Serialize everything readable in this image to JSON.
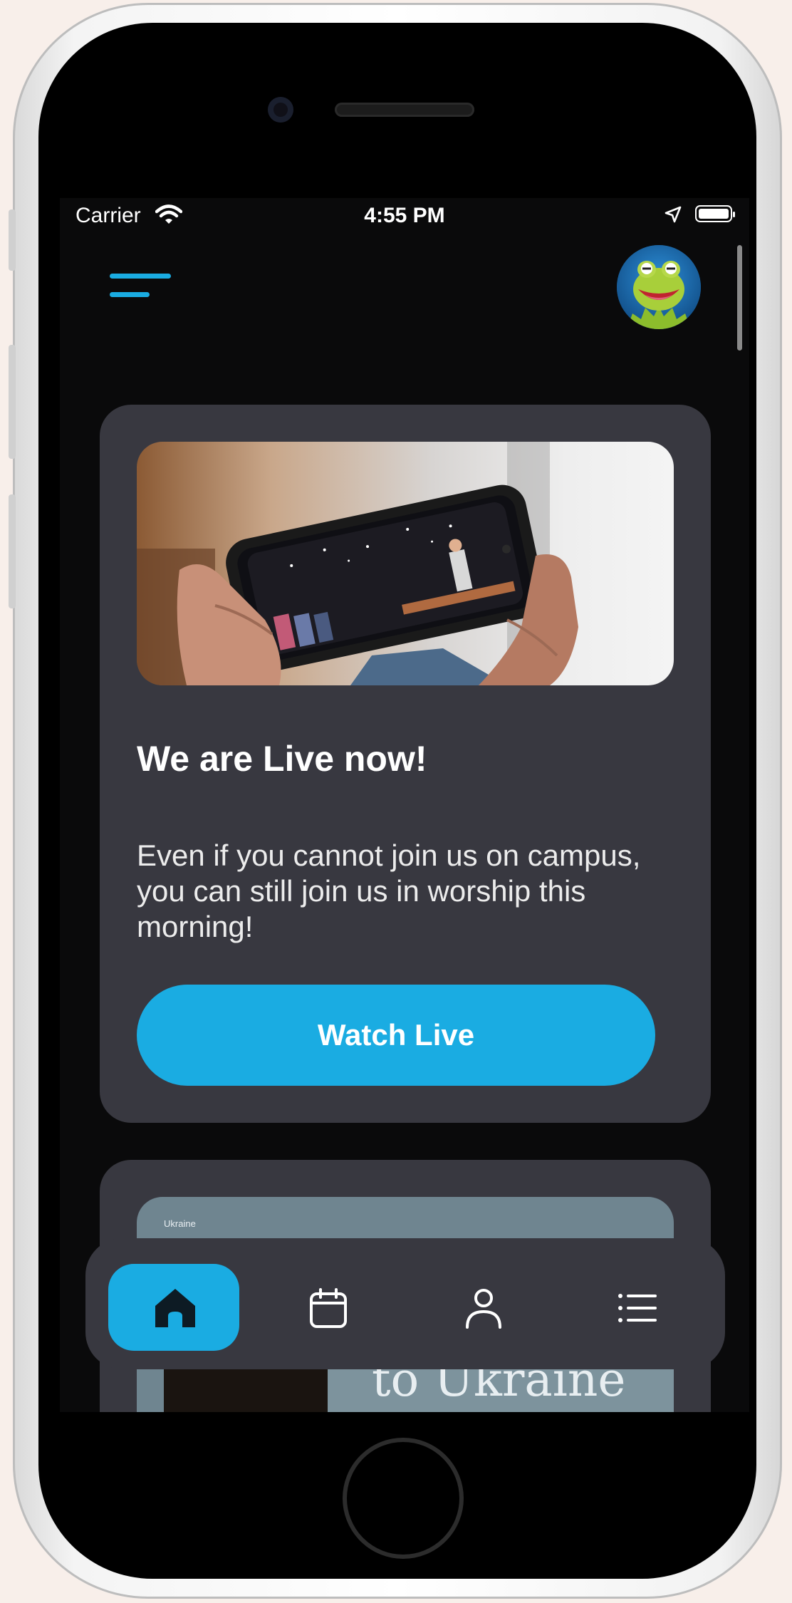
{
  "status_bar": {
    "carrier": "Carrier",
    "time": "4:55 PM",
    "wifi_icon": "wifi-icon",
    "location_icon": "location-arrow-icon",
    "battery_icon": "battery-icon"
  },
  "header": {
    "menu_icon": "hamburger-menu-icon",
    "avatar_icon": "frog-avatar"
  },
  "live_card": {
    "image": "phone-livestream-photo",
    "title": "We are Live now!",
    "body": "Even if you cannot join us on campus, you can still join us in worship this morning!",
    "button_label": "Watch Live"
  },
  "ukraine_card": {
    "tag": "Ukraine",
    "headline": "to Ukraine"
  },
  "tab_bar": {
    "tabs": [
      {
        "icon": "home-icon",
        "active": true
      },
      {
        "icon": "calendar-icon",
        "active": false
      },
      {
        "icon": "profile-icon",
        "active": false
      },
      {
        "icon": "list-icon",
        "active": false
      }
    ]
  },
  "colors": {
    "accent": "#1aace2",
    "card": "#383840",
    "background": "#0a0a0b"
  }
}
